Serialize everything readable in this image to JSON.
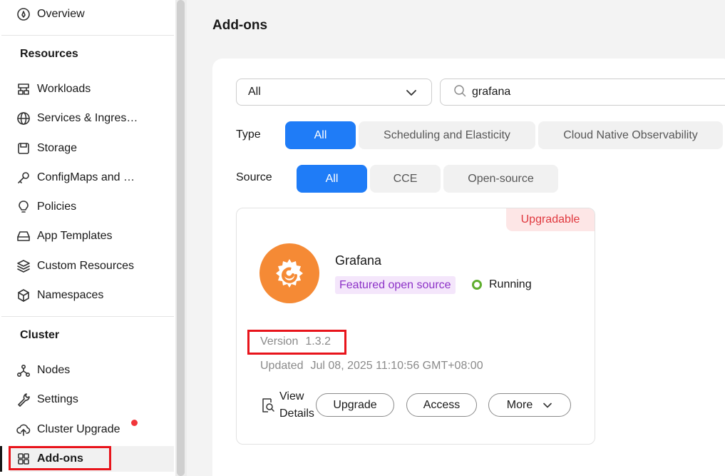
{
  "sidebar": {
    "top_item": {
      "label": "Overview",
      "icon": "overview-icon"
    },
    "sections": [
      {
        "title": "Resources"
      },
      {
        "title": "Cluster"
      }
    ],
    "resources": [
      {
        "label": "Workloads",
        "icon": "workloads-icon"
      },
      {
        "label": "Services & Ingres…",
        "icon": "globe-icon"
      },
      {
        "label": "Storage",
        "icon": "storage-icon"
      },
      {
        "label": "ConfigMaps and …",
        "icon": "key-icon"
      },
      {
        "label": "Policies",
        "icon": "lightbulb-icon"
      },
      {
        "label": "App Templates",
        "icon": "app-templates-icon"
      },
      {
        "label": "Custom Resources",
        "icon": "layers-icon"
      },
      {
        "label": "Namespaces",
        "icon": "cube-icon"
      }
    ],
    "cluster": [
      {
        "label": "Nodes",
        "icon": "nodes-icon"
      },
      {
        "label": "Settings",
        "icon": "wrench-icon"
      },
      {
        "label": "Cluster Upgrade",
        "icon": "cloud-upload-icon",
        "has_alert": true
      },
      {
        "label": "Add-ons",
        "icon": "grid-icon",
        "active": true
      }
    ]
  },
  "page": {
    "title": "Add-ons"
  },
  "filters": {
    "category_select": "All",
    "search_value": "grafana",
    "type_label": "Type",
    "type_options": [
      "All",
      "Scheduling and Elasticity",
      "Cloud Native Observability"
    ],
    "type_selected": "All",
    "source_label": "Source",
    "source_options": [
      "All",
      "CCE",
      "Open-source"
    ],
    "source_selected": "All"
  },
  "addon": {
    "badge": "Upgradable",
    "name": "Grafana",
    "tag": "Featured open source",
    "status": "Running",
    "version_label": "Version",
    "version": "1.3.2",
    "updated_label": "Updated",
    "updated": "Jul 08, 2025 11:10:56 GMT+08:00",
    "view_details": "View Details",
    "buttons": {
      "upgrade": "Upgrade",
      "access": "Access",
      "more": "More"
    }
  },
  "colors": {
    "accent": "#1f7cf7",
    "alert": "#f1353a",
    "badge_text": "#e0383e",
    "tag_text": "#8c31c7",
    "running": "#5fae2e",
    "logo": "#f58a35"
  }
}
